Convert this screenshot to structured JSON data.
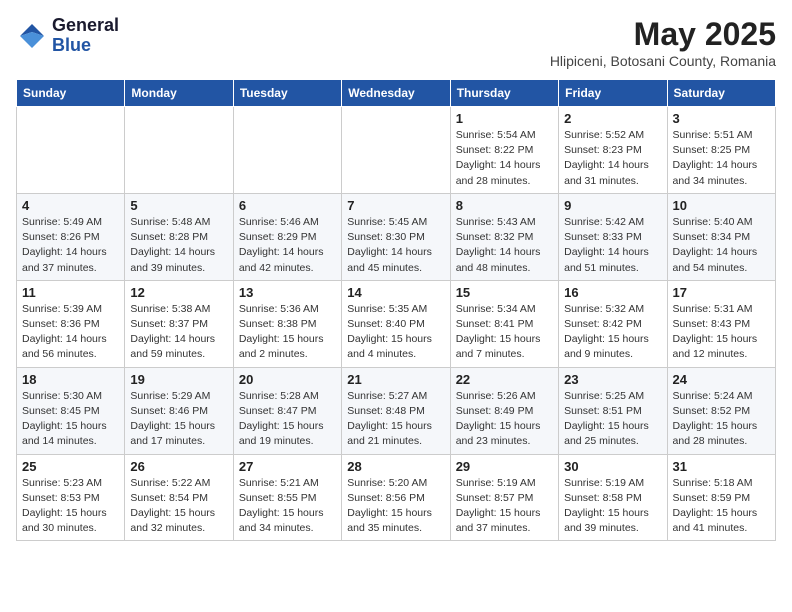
{
  "logo": {
    "general": "General",
    "blue": "Blue"
  },
  "title": {
    "month_year": "May 2025",
    "location": "Hlipiceni, Botosani County, Romania"
  },
  "days_of_week": [
    "Sunday",
    "Monday",
    "Tuesday",
    "Wednesday",
    "Thursday",
    "Friday",
    "Saturday"
  ],
  "weeks": [
    [
      {
        "day": "",
        "info": ""
      },
      {
        "day": "",
        "info": ""
      },
      {
        "day": "",
        "info": ""
      },
      {
        "day": "",
        "info": ""
      },
      {
        "day": "1",
        "info": "Sunrise: 5:54 AM\nSunset: 8:22 PM\nDaylight: 14 hours and 28 minutes."
      },
      {
        "day": "2",
        "info": "Sunrise: 5:52 AM\nSunset: 8:23 PM\nDaylight: 14 hours and 31 minutes."
      },
      {
        "day": "3",
        "info": "Sunrise: 5:51 AM\nSunset: 8:25 PM\nDaylight: 14 hours and 34 minutes."
      }
    ],
    [
      {
        "day": "4",
        "info": "Sunrise: 5:49 AM\nSunset: 8:26 PM\nDaylight: 14 hours and 37 minutes."
      },
      {
        "day": "5",
        "info": "Sunrise: 5:48 AM\nSunset: 8:28 PM\nDaylight: 14 hours and 39 minutes."
      },
      {
        "day": "6",
        "info": "Sunrise: 5:46 AM\nSunset: 8:29 PM\nDaylight: 14 hours and 42 minutes."
      },
      {
        "day": "7",
        "info": "Sunrise: 5:45 AM\nSunset: 8:30 PM\nDaylight: 14 hours and 45 minutes."
      },
      {
        "day": "8",
        "info": "Sunrise: 5:43 AM\nSunset: 8:32 PM\nDaylight: 14 hours and 48 minutes."
      },
      {
        "day": "9",
        "info": "Sunrise: 5:42 AM\nSunset: 8:33 PM\nDaylight: 14 hours and 51 minutes."
      },
      {
        "day": "10",
        "info": "Sunrise: 5:40 AM\nSunset: 8:34 PM\nDaylight: 14 hours and 54 minutes."
      }
    ],
    [
      {
        "day": "11",
        "info": "Sunrise: 5:39 AM\nSunset: 8:36 PM\nDaylight: 14 hours and 56 minutes."
      },
      {
        "day": "12",
        "info": "Sunrise: 5:38 AM\nSunset: 8:37 PM\nDaylight: 14 hours and 59 minutes."
      },
      {
        "day": "13",
        "info": "Sunrise: 5:36 AM\nSunset: 8:38 PM\nDaylight: 15 hours and 2 minutes."
      },
      {
        "day": "14",
        "info": "Sunrise: 5:35 AM\nSunset: 8:40 PM\nDaylight: 15 hours and 4 minutes."
      },
      {
        "day": "15",
        "info": "Sunrise: 5:34 AM\nSunset: 8:41 PM\nDaylight: 15 hours and 7 minutes."
      },
      {
        "day": "16",
        "info": "Sunrise: 5:32 AM\nSunset: 8:42 PM\nDaylight: 15 hours and 9 minutes."
      },
      {
        "day": "17",
        "info": "Sunrise: 5:31 AM\nSunset: 8:43 PM\nDaylight: 15 hours and 12 minutes."
      }
    ],
    [
      {
        "day": "18",
        "info": "Sunrise: 5:30 AM\nSunset: 8:45 PM\nDaylight: 15 hours and 14 minutes."
      },
      {
        "day": "19",
        "info": "Sunrise: 5:29 AM\nSunset: 8:46 PM\nDaylight: 15 hours and 17 minutes."
      },
      {
        "day": "20",
        "info": "Sunrise: 5:28 AM\nSunset: 8:47 PM\nDaylight: 15 hours and 19 minutes."
      },
      {
        "day": "21",
        "info": "Sunrise: 5:27 AM\nSunset: 8:48 PM\nDaylight: 15 hours and 21 minutes."
      },
      {
        "day": "22",
        "info": "Sunrise: 5:26 AM\nSunset: 8:49 PM\nDaylight: 15 hours and 23 minutes."
      },
      {
        "day": "23",
        "info": "Sunrise: 5:25 AM\nSunset: 8:51 PM\nDaylight: 15 hours and 25 minutes."
      },
      {
        "day": "24",
        "info": "Sunrise: 5:24 AM\nSunset: 8:52 PM\nDaylight: 15 hours and 28 minutes."
      }
    ],
    [
      {
        "day": "25",
        "info": "Sunrise: 5:23 AM\nSunset: 8:53 PM\nDaylight: 15 hours and 30 minutes."
      },
      {
        "day": "26",
        "info": "Sunrise: 5:22 AM\nSunset: 8:54 PM\nDaylight: 15 hours and 32 minutes."
      },
      {
        "day": "27",
        "info": "Sunrise: 5:21 AM\nSunset: 8:55 PM\nDaylight: 15 hours and 34 minutes."
      },
      {
        "day": "28",
        "info": "Sunrise: 5:20 AM\nSunset: 8:56 PM\nDaylight: 15 hours and 35 minutes."
      },
      {
        "day": "29",
        "info": "Sunrise: 5:19 AM\nSunset: 8:57 PM\nDaylight: 15 hours and 37 minutes."
      },
      {
        "day": "30",
        "info": "Sunrise: 5:19 AM\nSunset: 8:58 PM\nDaylight: 15 hours and 39 minutes."
      },
      {
        "day": "31",
        "info": "Sunrise: 5:18 AM\nSunset: 8:59 PM\nDaylight: 15 hours and 41 minutes."
      }
    ]
  ]
}
